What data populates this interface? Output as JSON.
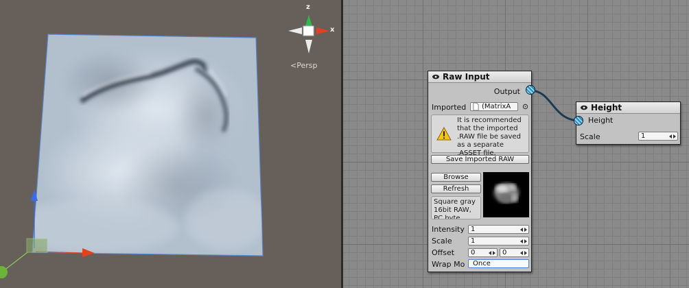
{
  "scene": {
    "gizmo": {
      "axis_z": "z",
      "axis_x": "x",
      "projection_label": "Persp"
    }
  },
  "raw_input_node": {
    "title": "Raw Input",
    "output_label": "Output",
    "imported_label": "Imported",
    "imported_value": "(MatrixA",
    "warning_text": "It is recommended that the imported .RAW file be saved as a separate .ASSET file.",
    "save_button": "Save Imported RAW",
    "browse_button": "Browse",
    "refresh_button": "Refresh",
    "info_text": "Square gray 16bit RAW, PC byte",
    "intensity_label": "Intensity",
    "intensity_value": "1",
    "scale_label": "Scale",
    "scale_value": "1",
    "offset_label": "Offset",
    "offset_x": "0",
    "offset_y": "0",
    "wrap_label": "Wrap Mo",
    "wrap_value": "Once"
  },
  "height_node": {
    "title": "Height",
    "input_label": "Height",
    "scale_label": "Scale",
    "scale_value": "1"
  }
}
